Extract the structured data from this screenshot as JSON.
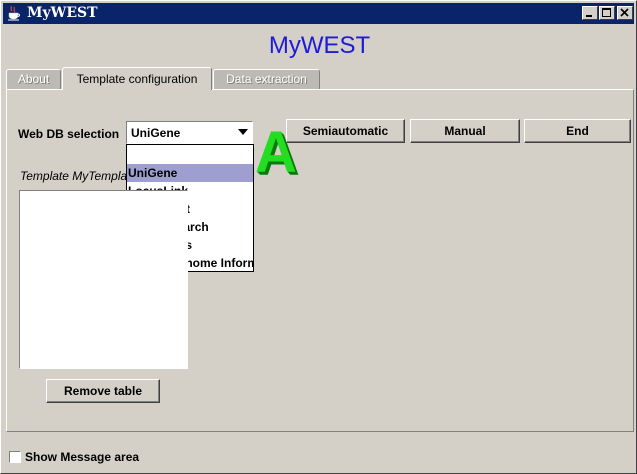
{
  "window": {
    "title": "MyWEST",
    "controls": [
      "minimize",
      "maximize",
      "close"
    ]
  },
  "app_heading": "MyWEST",
  "tabs": [
    {
      "label": "About",
      "active": false
    },
    {
      "label": "Template configuration",
      "active": true
    },
    {
      "label": "Data extraction",
      "active": false
    }
  ],
  "db_selection": {
    "label": "Web DB selection",
    "value": "UniGene",
    "options": [
      "",
      "UniGene",
      "LocusLink",
      "Swiss-Prot",
      "SourceSearch",
      "GeneCards",
      "Mouse Genome Inform"
    ],
    "highlighted": "UniGene"
  },
  "buttons": {
    "semiautomatic": "Semiautomatic",
    "manual": "Manual",
    "end": "End",
    "remove_table": "Remove table"
  },
  "template": {
    "label": "Template MyTemplate"
  },
  "annotation": {
    "letter": "A",
    "color": "#22dd22"
  },
  "footer": {
    "show_message_label": "Show Message area",
    "show_message_checked": false
  },
  "colors": {
    "titlebar": "#0a246a",
    "heading": "#1c1cd8",
    "selection": "#9e9ed0"
  }
}
